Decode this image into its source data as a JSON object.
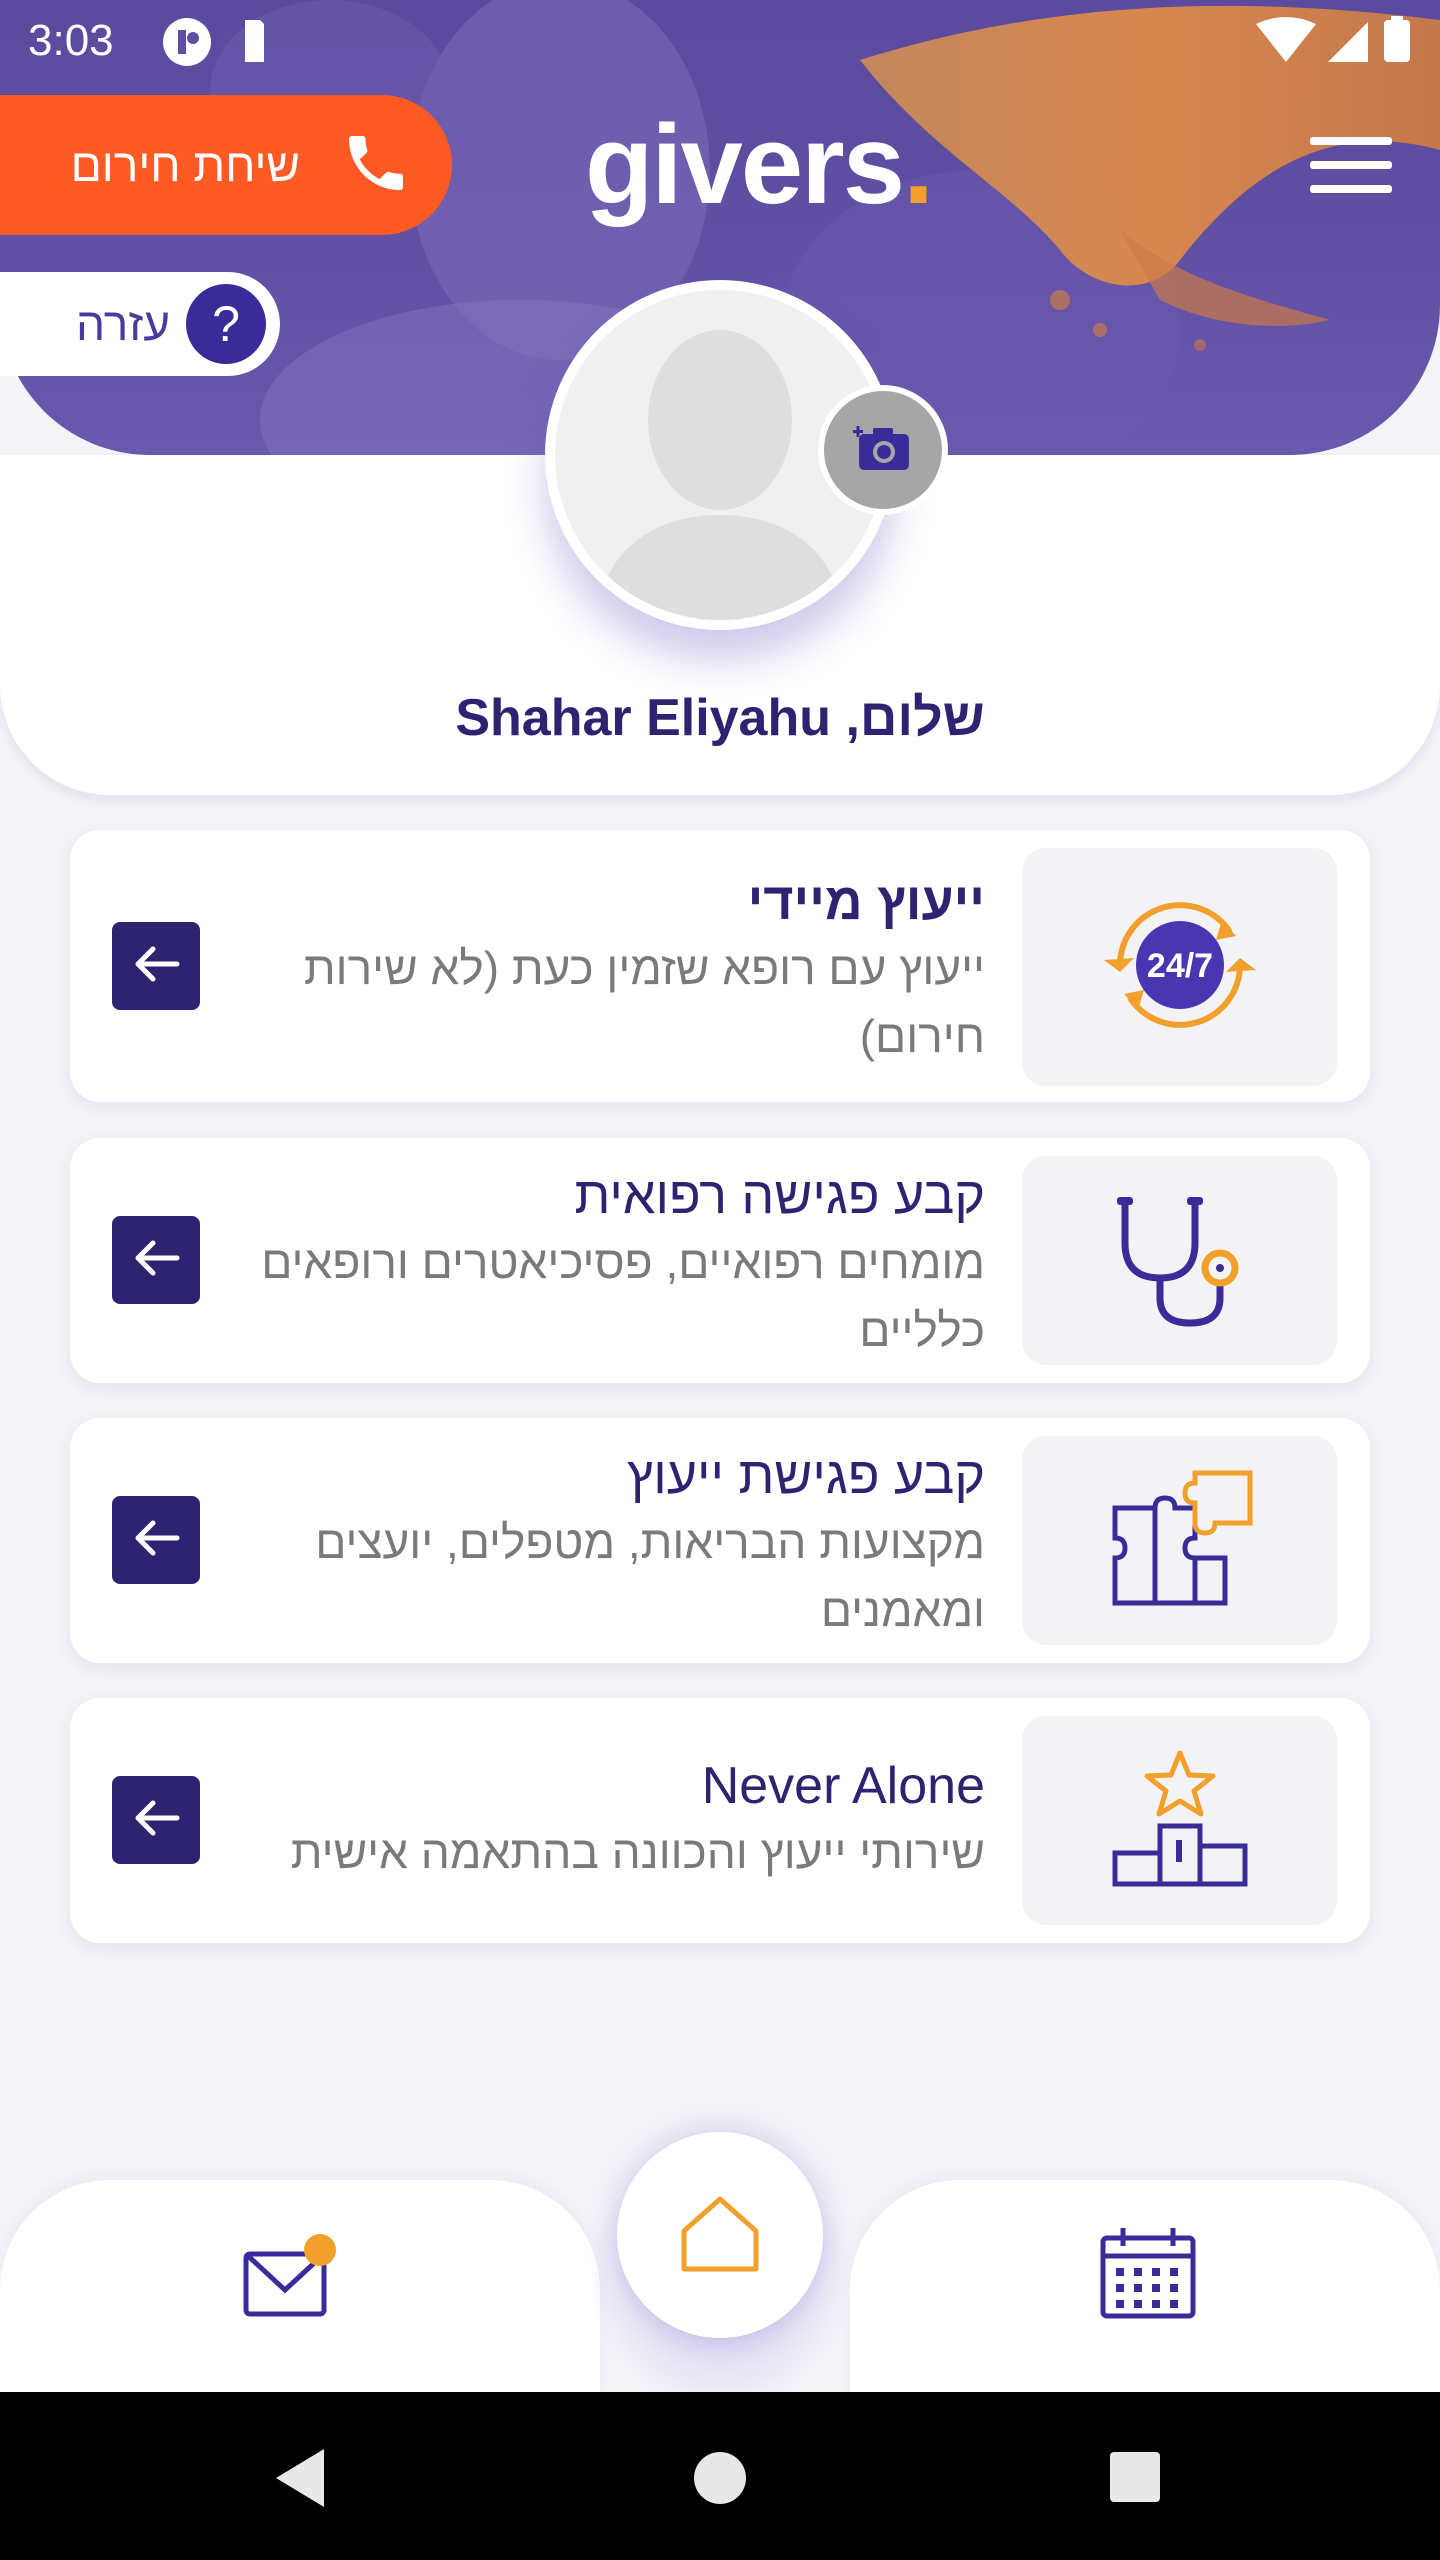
{
  "status_bar": {
    "time": "3:03"
  },
  "header": {
    "emergency_label": "שיחת חירום",
    "help_label": "עזרה",
    "help_icon_glyph": "?",
    "logo_text": "givers",
    "logo_dot": "."
  },
  "profile": {
    "greeting": "שלום, Shahar Eliyahu"
  },
  "cards": [
    {
      "title": "ייעוץ מיידי",
      "subtitle": "ייעוץ עם רופא שזמין כעת (לא שירות חירום)",
      "icon": "24-7-icon",
      "icon_text": "24/7"
    },
    {
      "title": "קבע פגישה רפואית",
      "subtitle": "מומחים רפואיים, פסיכיאטרים ורופאים כלליים",
      "icon": "stethoscope-icon"
    },
    {
      "title": "קבע פגישת ייעוץ",
      "subtitle": "מקצועות הבריאות, מטפלים, יועצים ומאמנים",
      "icon": "puzzle-icon"
    },
    {
      "title": "Never Alone",
      "subtitle": "שירותי ייעוץ והכוונה בהתאמה אישית",
      "icon": "podium-star-icon"
    }
  ],
  "bottom_nav": {
    "items": [
      "mail-icon",
      "home-icon",
      "calendar-icon"
    ]
  },
  "colors": {
    "primary": "#2e2370",
    "accent_orange": "#f2a02b",
    "emergency": "#ff5a24",
    "hero_purple": "#5e4da1"
  }
}
